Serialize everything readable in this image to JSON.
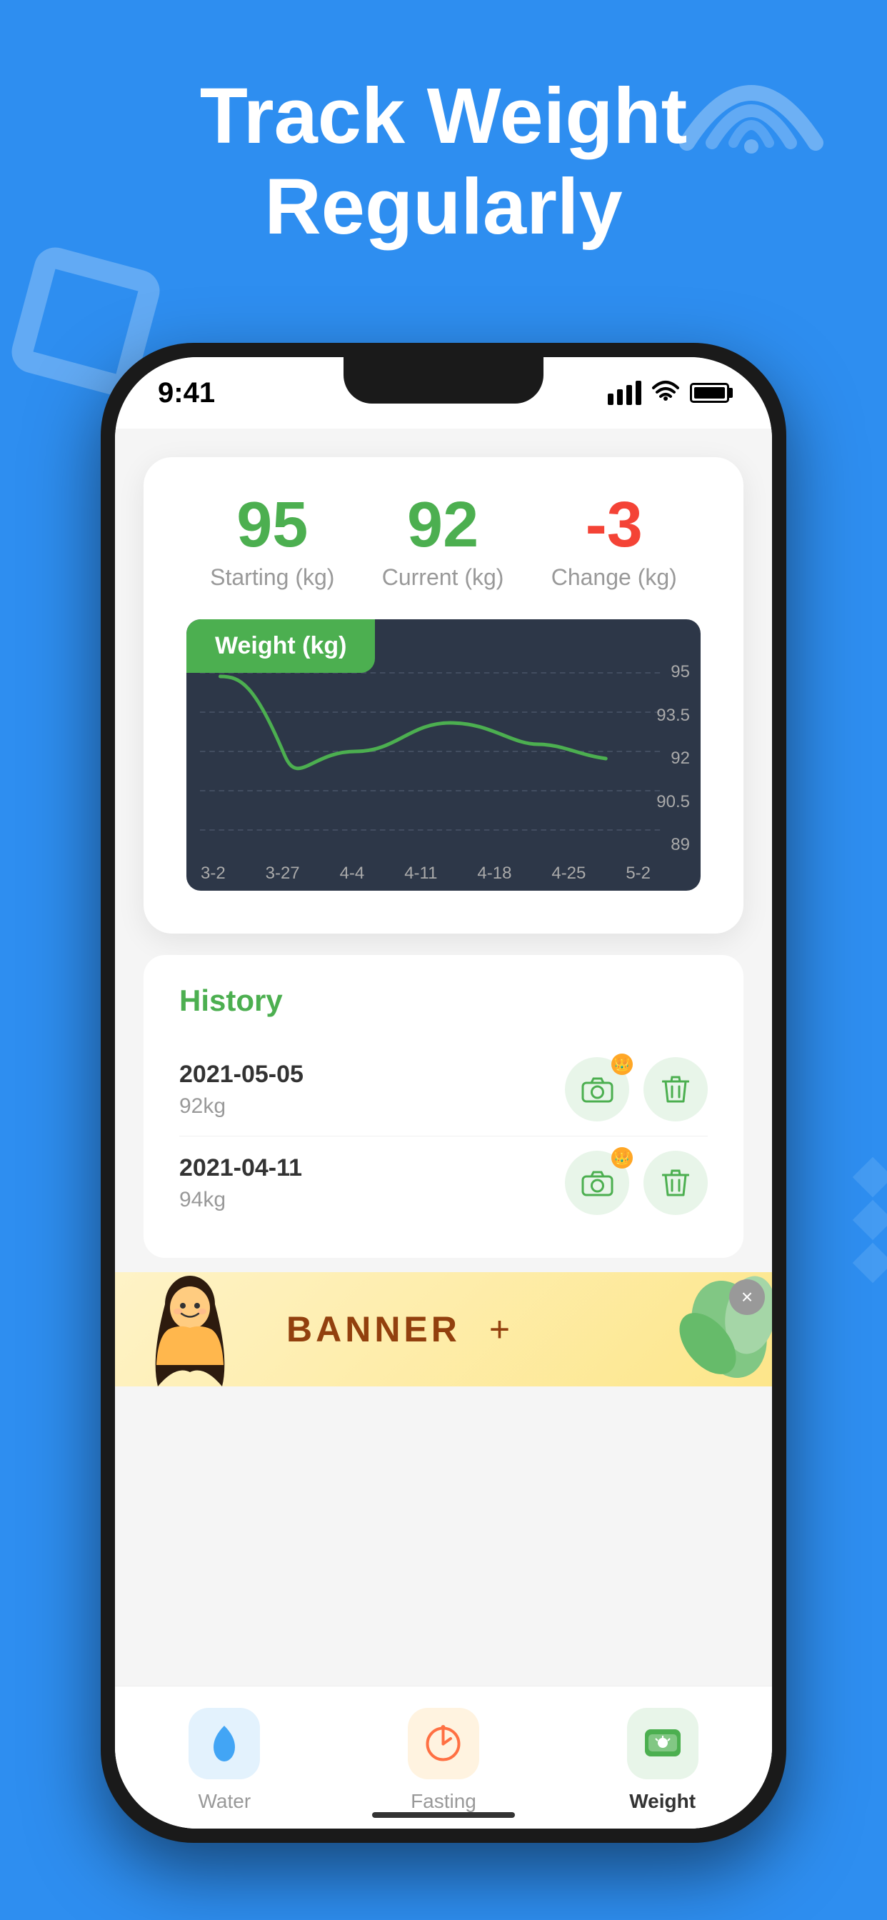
{
  "background": {
    "color": "#2E8EF0"
  },
  "header": {
    "title_line1": "Track Weight",
    "title_line2": "Regularly"
  },
  "status_bar": {
    "time": "9:41"
  },
  "stats": {
    "starting_value": "95",
    "starting_label": "Starting (kg)",
    "current_value": "92",
    "current_label": "Current (kg)",
    "change_value": "-3",
    "change_label": "Change (kg)"
  },
  "chart": {
    "title": "Weight  (kg)",
    "y_labels": [
      "95",
      "93.5",
      "92",
      "90.5",
      "89"
    ],
    "x_labels": [
      "3-2",
      "3-27",
      "4-4",
      "4-11",
      "4-18",
      "4-25",
      "5-2"
    ]
  },
  "history": {
    "title": "History",
    "items": [
      {
        "date": "2021-05-05",
        "weight": "92kg"
      },
      {
        "date": "2021-04-11",
        "weight": "94kg"
      }
    ]
  },
  "banner": {
    "text": "BANNER",
    "close_label": "×"
  },
  "tabs": [
    {
      "id": "water",
      "label": "Water",
      "active": false,
      "icon": "💧"
    },
    {
      "id": "fasting",
      "label": "Fasting",
      "active": false,
      "icon": "⏰"
    },
    {
      "id": "weight",
      "label": "Weight",
      "active": true,
      "icon": "⚖️"
    }
  ]
}
